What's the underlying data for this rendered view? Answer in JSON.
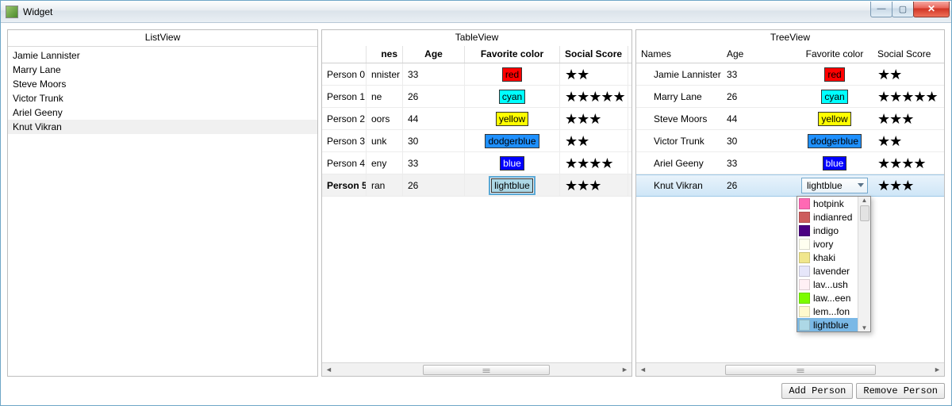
{
  "window": {
    "title": "Widget"
  },
  "panels": {
    "list_title": "ListView",
    "table_title": "TableView",
    "tree_title": "TreeView"
  },
  "columns": {
    "id_partial": "nes",
    "names": "Names",
    "age": "Age",
    "fav": "Favorite color",
    "score": "Social Score"
  },
  "list": {
    "items": [
      "Jamie Lannister",
      "Marry Lane",
      "Steve Moors",
      "Victor Trunk",
      "Ariel Geeny",
      "Knut Vikran"
    ],
    "selected_index": 5
  },
  "people": [
    {
      "id": "Person 0",
      "name_frag": "nnister",
      "name": "Jamie Lannister",
      "age": 33,
      "color": "red",
      "color_css": "#ff0000",
      "chip_fg": "#000",
      "stars": 2
    },
    {
      "id": "Person 1",
      "name_frag": "ne",
      "name": "Marry Lane",
      "age": 26,
      "color": "cyan",
      "color_css": "#00ffff",
      "chip_fg": "#000",
      "stars": 5
    },
    {
      "id": "Person 2",
      "name_frag": "oors",
      "name": "Steve Moors",
      "age": 44,
      "color": "yellow",
      "color_css": "#ffff00",
      "chip_fg": "#000",
      "stars": 3
    },
    {
      "id": "Person 3",
      "name_frag": "unk",
      "name": "Victor Trunk",
      "age": 30,
      "color": "dodgerblue",
      "color_css": "#1e90ff",
      "chip_fg": "#000",
      "stars": 2
    },
    {
      "id": "Person 4",
      "name_frag": "eny",
      "name": "Ariel Geeny",
      "age": 33,
      "color": "blue",
      "color_css": "#0000ff",
      "chip_fg": "#fff",
      "stars": 4
    },
    {
      "id": "Person 5",
      "name_frag": "ran",
      "name": "Knut Vikran",
      "age": 26,
      "color": "lightblue",
      "color_css": "#add8e6",
      "chip_fg": "#000",
      "stars": 3
    }
  ],
  "table_selected_index": 5,
  "tree_selected_index": 5,
  "dropdown": {
    "open_for_index": 5,
    "selected": "lightblue",
    "options": [
      {
        "label": "hotpink",
        "swatch": "#ff69b4"
      },
      {
        "label": "indianred",
        "swatch": "#cd5c5c"
      },
      {
        "label": "indigo",
        "swatch": "#4b0082"
      },
      {
        "label": "ivory",
        "swatch": "#fffff0"
      },
      {
        "label": "khaki",
        "swatch": "#f0e68c"
      },
      {
        "label": "lavender",
        "swatch": "#e6e6fa"
      },
      {
        "label": "lav...ush",
        "swatch": "#fff0f5"
      },
      {
        "label": "law...een",
        "swatch": "#7cfc00"
      },
      {
        "label": "lem...fon",
        "swatch": "#fffacd"
      },
      {
        "label": "lightblue",
        "swatch": "#add8e6"
      }
    ]
  },
  "buttons": {
    "add": "Add Person",
    "remove": "Remove Person"
  }
}
